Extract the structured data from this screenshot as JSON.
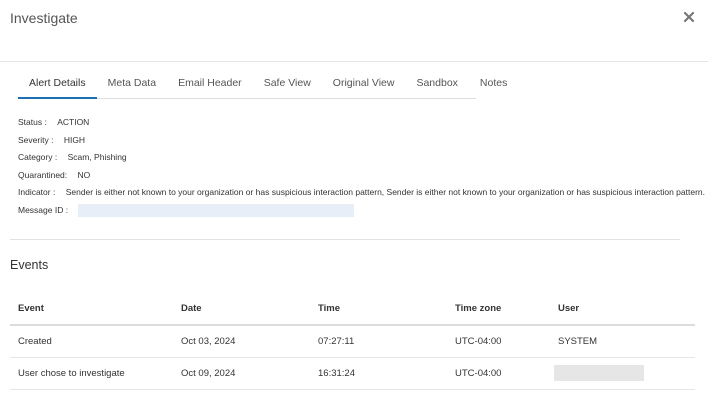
{
  "window": {
    "title": "Investigate"
  },
  "tabs": [
    {
      "label": "Alert Details",
      "active": true
    },
    {
      "label": "Meta Data"
    },
    {
      "label": "Email Header"
    },
    {
      "label": "Safe View"
    },
    {
      "label": "Original View"
    },
    {
      "label": "Sandbox"
    },
    {
      "label": "Notes"
    }
  ],
  "details": {
    "status_label": "Status :",
    "status_value": "ACTION",
    "severity_label": "Severity :",
    "severity_value": "HIGH",
    "category_label": "Category :",
    "category_value": "Scam, Phishing",
    "quarantined_label": "Quarantined:",
    "quarantined_value": "NO",
    "indicator_label": "Indicator :",
    "indicator_value": "Sender is either not known to your organization or has suspicious interaction pattern, Sender is either not known to your organization or has suspicious interaction pattern.",
    "message_id_label": "Message ID :"
  },
  "events": {
    "title": "Events",
    "columns": [
      "Event",
      "Date",
      "Time",
      "Time zone",
      "User"
    ],
    "rows": [
      {
        "event": "Created",
        "date": "Oct 03, 2024",
        "time": "07:27:11",
        "tz": "UTC-04:00",
        "user": "SYSTEM"
      },
      {
        "event": "User chose to investigate",
        "date": "Oct 09, 2024",
        "time": "16:31:24",
        "tz": "UTC-04:00",
        "user": ""
      }
    ]
  },
  "colors": {
    "accent": "#1a6fb5",
    "redacted": "#e8eef8"
  },
  "icons": {
    "close": "close-icon"
  }
}
